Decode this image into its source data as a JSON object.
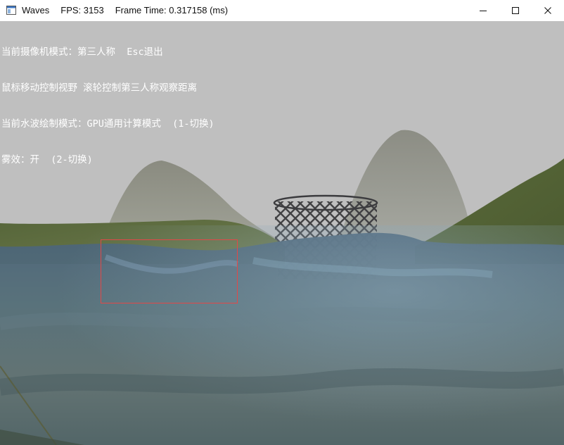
{
  "window": {
    "title": "Waves",
    "fps_label": "FPS: 3153",
    "frame_time_label": "Frame Time: 0.317158 (ms)"
  },
  "controls": {
    "minimize_icon": "minimize-icon",
    "maximize_icon": "maximize-icon",
    "close_icon": "close-icon"
  },
  "overlay": {
    "lines": [
      "当前摄像机模式：第三人称  Esc退出",
      "鼠标移动控制视野 滚轮控制第三人称观察距离",
      "当前水波绘制模式：GPU通用计算模式  (1-切换)",
      "雾效：开  (2-切换)"
    ]
  },
  "colors": {
    "sky": "#bfbfbf",
    "water": "#4f6a7a",
    "grass": "#5b6b3c",
    "selection": "#e24848"
  }
}
